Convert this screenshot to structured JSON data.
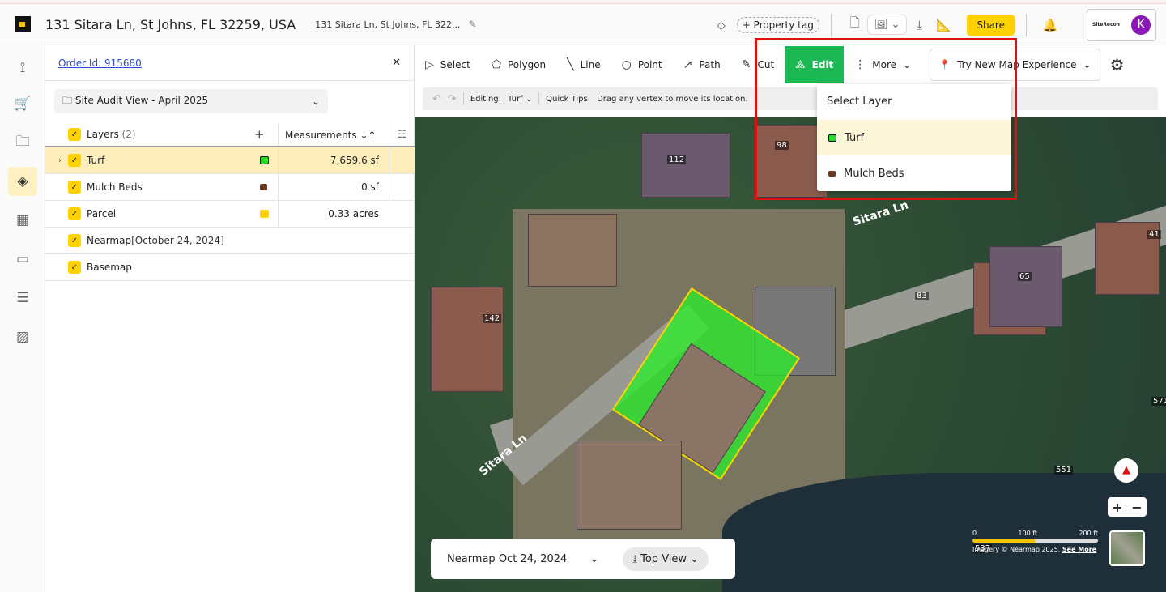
{
  "header": {
    "title": "131 Sitara Ln, St Johns, FL 32259, USA",
    "subtitle": "131 Sitara Ln, St Johns, FL 322...",
    "property_tag": "+ Property tag",
    "share": "Share",
    "brand": "SiteRecon",
    "avatar": "K"
  },
  "panel": {
    "order_id": "Order Id: 915680",
    "view": "Site Audit View - April 2025",
    "layers_header": "Layers",
    "layers_count": "(2)",
    "measurements_header": "Measurements",
    "layers": [
      {
        "name": "Turf",
        "measurement": "7,659.6 sf",
        "color": "#22dd22"
      },
      {
        "name": "Mulch Beds",
        "measurement": "0 sf",
        "color": "#6b3a1e"
      },
      {
        "name": "Parcel",
        "measurement": "0.33 acres",
        "color": "#ffd200"
      },
      {
        "name": "Nearmap",
        "date": "[October 24, 2024]"
      },
      {
        "name": "Basemap"
      }
    ]
  },
  "toolbar": {
    "select": "Select",
    "polygon": "Polygon",
    "line": "Line",
    "point": "Point",
    "path": "Path",
    "cut": "Cut",
    "edit": "Edit",
    "more": "More",
    "map_experience": "Try New Map Experience"
  },
  "subbar": {
    "editing_label": "Editing:",
    "editing_value": "Turf",
    "tips_label": "Quick Tips:",
    "tips": "Drag any vertex to move its location."
  },
  "dropdown": {
    "title": "Select Layer",
    "items": [
      {
        "name": "Turf",
        "color": "#22dd22"
      },
      {
        "name": "Mulch Beds",
        "color": "#6b3a1e"
      }
    ]
  },
  "map": {
    "street": "Sitara Ln",
    "house_numbers": [
      "112",
      "98",
      "41",
      "65",
      "83",
      "142",
      "571",
      "551",
      "537"
    ],
    "imagery_date": "Nearmap Oct 24, 2024",
    "view_mode": "Top View",
    "scale": {
      "zero": "0",
      "mid": "100 ft",
      "max": "200 ft"
    },
    "attribution": "Imagery © Nearmap 2025,",
    "see_more": "See More"
  },
  "colors": {
    "accent": "#ffd200",
    "edit_active": "#1db954",
    "highlight": "#e01010"
  }
}
